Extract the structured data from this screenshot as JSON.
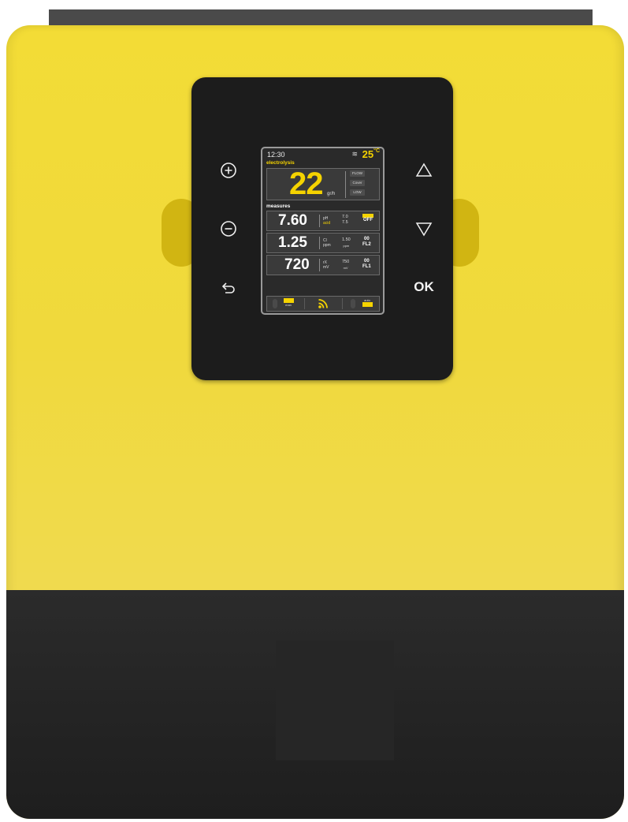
{
  "status": {
    "time": "12:30",
    "temperature": "25",
    "temperature_unit": "°C"
  },
  "electrolysis": {
    "title": "electrolysis",
    "value": "22",
    "unit": "gr/h",
    "tags": [
      "FLOW",
      "Cover",
      "LOW"
    ]
  },
  "measures": {
    "title": "measures",
    "rows": [
      {
        "value": "7.60",
        "label": "pH",
        "sublabel": "acid",
        "set_top": "7.0",
        "set_bottom": "7.5",
        "status": "OFF",
        "status_top": ""
      },
      {
        "value": "1.25",
        "label": "Cl",
        "sublabel": "ppm",
        "set_top": "1.50",
        "set_bottom": "ppm",
        "status_top": "00",
        "status": "FL2"
      },
      {
        "value": "720",
        "label": "rX",
        "sublabel": "mV",
        "set_top": "750",
        "set_bottom": "mV",
        "status_top": "00",
        "status": "FL1"
      }
    ]
  },
  "footer": {
    "left_label": "man",
    "right_label": "auto"
  },
  "buttons": {
    "ok_label": "OK"
  },
  "colors": {
    "accent": "#f5d300",
    "housing": "#f0d93c",
    "panel": "#1c1c1c"
  },
  "icons": [
    "plus-icon",
    "minus-icon",
    "back-arrow-icon",
    "up-triangle-icon",
    "down-triangle-icon",
    "wifi-icon",
    "thermometer-icon"
  ]
}
